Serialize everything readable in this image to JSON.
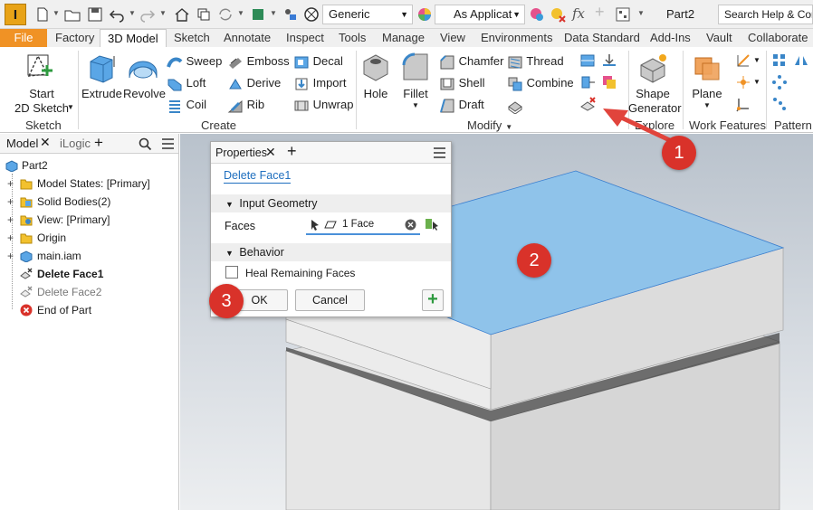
{
  "app": {
    "logo": "I",
    "title": "Part2"
  },
  "qat": {
    "material": "Generic",
    "appearance": "As Applicat",
    "search": "Search Help & Commands"
  },
  "tabs": [
    "File",
    "Factory",
    "3D Model",
    "Sketch",
    "Annotate",
    "Inspect",
    "Tools",
    "Manage",
    "View",
    "Environments",
    "Data Standard",
    "Add-Ins",
    "Vault",
    "Collaborate"
  ],
  "ribbon": {
    "sketch": {
      "start_label": "Start",
      "sketch_label": "2D Sketch",
      "panel": "Sketch"
    },
    "create": {
      "extrude": "Extrude",
      "revolve": "Revolve",
      "sweep": "Sweep",
      "loft": "Loft",
      "coil": "Coil",
      "emboss": "Emboss",
      "derive": "Derive",
      "rib": "Rib",
      "decal": "Decal",
      "import": "Import",
      "unwrap": "Unwrap",
      "panel": "Create"
    },
    "modify": {
      "hole": "Hole",
      "fillet": "Fillet",
      "chamfer": "Chamfer",
      "shell": "Shell",
      "draft": "Draft",
      "thread": "Thread",
      "combine": "Combine",
      "panel": "Modify"
    },
    "explore": {
      "shape": "Shape",
      "generator": "Generator",
      "panel": "Explore"
    },
    "work": {
      "plane": "Plane",
      "panel": "Work Features"
    },
    "pattern": {
      "panel": "Pattern"
    }
  },
  "browser": {
    "tab_model": "Model",
    "tab_ilogic": "iLogic",
    "items": [
      {
        "label": "Part2"
      },
      {
        "label": "Model States: [Primary]"
      },
      {
        "label": "Solid Bodies(2)"
      },
      {
        "label": "View: [Primary]"
      },
      {
        "label": "Origin"
      },
      {
        "label": "main.iam"
      },
      {
        "label": "Delete Face1"
      },
      {
        "label": "Delete Face2"
      },
      {
        "label": "End of Part"
      }
    ]
  },
  "props": {
    "tab": "Properties",
    "feature_name": "Delete Face1",
    "section_input": "Input Geometry",
    "faces_label": "Faces",
    "faces_value": "1 Face",
    "section_behavior": "Behavior",
    "heal_label": "Heal Remaining Faces",
    "ok": "OK",
    "cancel": "Cancel"
  },
  "callouts": [
    "1",
    "2",
    "3"
  ],
  "colors": {
    "accent": "#f09225",
    "selected_face": "#8fc3ea",
    "callout": "#d9322a",
    "link": "#1f6fbf"
  }
}
